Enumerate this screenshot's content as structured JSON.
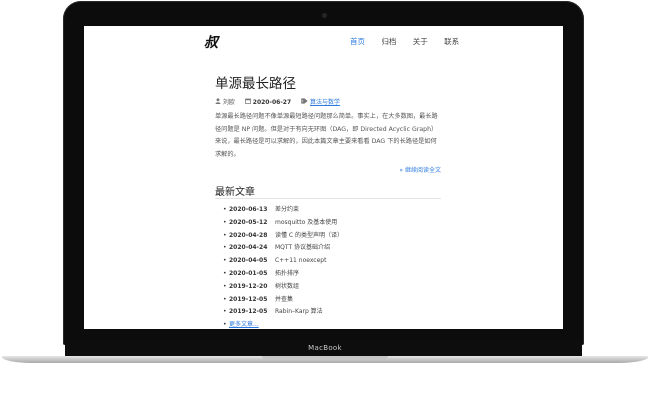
{
  "device": {
    "label": "MacBook"
  },
  "site": {
    "logo": "叔",
    "nav": [
      {
        "label": "首页",
        "active": true
      },
      {
        "label": "归档",
        "active": false
      },
      {
        "label": "关于",
        "active": false
      },
      {
        "label": "联系",
        "active": false
      }
    ]
  },
  "post": {
    "title": "单源最长路径",
    "author": "刘欧",
    "date": "2020-06-27",
    "category": "算法与数学",
    "excerpt": "单源最长路径问题不像单源最短路径问题那么简单。事实上，在大多数图，最长路径问题是 NP 问题。但是对于有向无环图（DAG，即 Directed Acyclic Graph）来说，最长路径是可以求解的，因此本篇文章主要来看看 DAG 下的长路径是如何求解的。",
    "read_more": "» 继续阅读全文"
  },
  "recent": {
    "heading": "最新文章",
    "items": [
      {
        "date": "2020-06-13",
        "title": "差分约束"
      },
      {
        "date": "2020-05-12",
        "title": "mosquitto 及基本使用"
      },
      {
        "date": "2020-04-28",
        "title": "读懂 C 的类型声明（译）"
      },
      {
        "date": "2020-04-24",
        "title": "MQTT 协议基础介绍"
      },
      {
        "date": "2020-04-05",
        "title": "C++11 noexcept"
      },
      {
        "date": "2020-01-05",
        "title": "拓扑排序"
      },
      {
        "date": "2019-12-20",
        "title": "树状数组"
      },
      {
        "date": "2019-12-05",
        "title": "并查集"
      },
      {
        "date": "2019-12-05",
        "title": "Rabin–Karp 算法"
      }
    ],
    "more": "更多文章..."
  }
}
